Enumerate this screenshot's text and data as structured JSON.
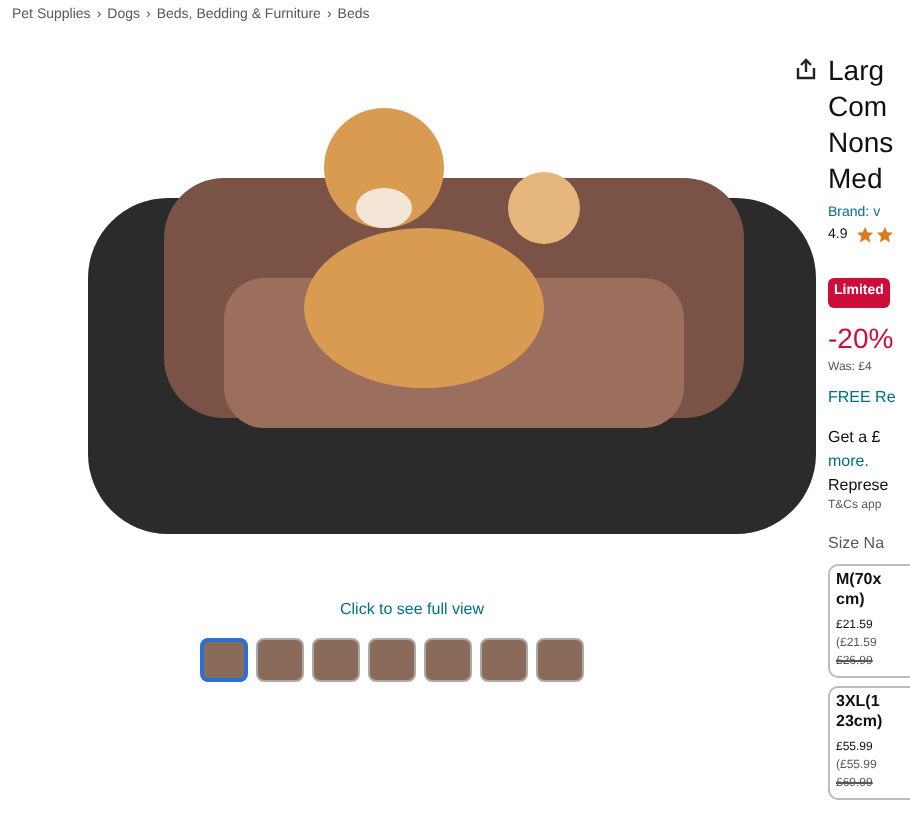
{
  "breadcrumb": {
    "items": [
      "Pet Supplies",
      "Dogs",
      "Beds, Bedding & Furniture",
      "Beds"
    ],
    "separator": "›"
  },
  "gallery": {
    "caption": "Click to see full view",
    "thumbnails": [
      {
        "selected": true
      },
      {
        "selected": false
      },
      {
        "selected": false
      },
      {
        "selected": false
      },
      {
        "selected": false
      },
      {
        "selected": false
      },
      {
        "selected": false
      }
    ]
  },
  "product": {
    "title_lines": [
      "Larg",
      "Com",
      "Nons",
      "Med"
    ],
    "brand": "Brand: v",
    "rating": "4.9",
    "deal_badge": "Limited",
    "discount": "-20%",
    "was_price": "Was: £4",
    "delivery": "FREE Re",
    "promo_lines": [
      "Get a £",
      "more.",
      "Represe"
    ],
    "terms": "T&Cs app",
    "size_label": "Size Na",
    "sizes": [
      {
        "name_lines": [
          "M(70x",
          "cm)"
        ],
        "price": "£21.59",
        "unit_price": "(£21.59",
        "list_price": "£26.99",
        "selected": false
      },
      {
        "name_lines": [
          "3XL(1",
          "23cm)"
        ],
        "price": "£55.99",
        "unit_price": "(£55.99",
        "list_price": "£69.99",
        "selected": false
      }
    ]
  }
}
